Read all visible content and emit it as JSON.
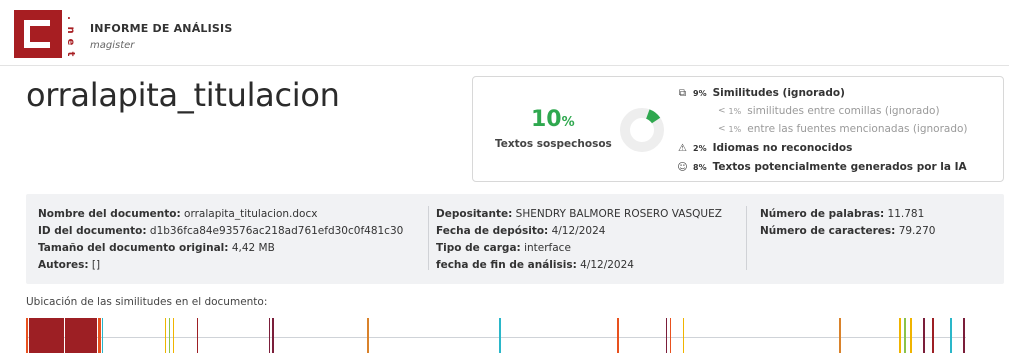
{
  "header": {
    "logo_letter": "C",
    "logo_suffix": ".net",
    "title": "INFORME DE ANÁLISIS",
    "subtitle": "magister",
    "brand_color": "#a71e22"
  },
  "document_title": "orralapita_titulacion",
  "score": {
    "percent_value": "10",
    "percent_symbol": "%",
    "label": "Textos sospechosos",
    "accent_color": "#2fa84f",
    "donut_fraction": 0.1
  },
  "metrics": [
    {
      "icon": "copy-icon",
      "glyph": "⧉",
      "percent": "9%",
      "label": "Similitudes (ignorado)",
      "sub": false
    },
    {
      "icon": "",
      "glyph": "",
      "lt": "<",
      "percent": "1%",
      "label": "similitudes entre comillas (ignorado)",
      "sub": true
    },
    {
      "icon": "",
      "glyph": "",
      "lt": "<",
      "percent": "1%",
      "label": "entre las fuentes mencionadas (ignorado)",
      "sub": true
    },
    {
      "icon": "language-warning-icon",
      "glyph": "⚠",
      "percent": "2%",
      "label": "Idiomas no reconocidos",
      "sub": false
    },
    {
      "icon": "ai-robot-icon",
      "glyph": "☺",
      "percent": "8%",
      "label": "Textos potencialmente generados por la IA",
      "sub": false
    }
  ],
  "info": {
    "col1": [
      {
        "key": "Nombre del documento:",
        "value": "orralapita_titulacion.docx"
      },
      {
        "key": "ID del documento:",
        "value": "d1b36fca84e93576ac218ad761efd30c0f481c30"
      },
      {
        "key": "Tamaño del documento original:",
        "value": "4,42 MB"
      },
      {
        "key": "Autores:",
        "value": "[]"
      }
    ],
    "col2": [
      {
        "key": "Depositante:",
        "value": "SHENDRY BALMORE ROSERO VASQUEZ"
      },
      {
        "key": "Fecha de depósito:",
        "value": "4/12/2024"
      },
      {
        "key": "Tipo de carga:",
        "value": "interface"
      },
      {
        "key": "fecha de fin de análisis:",
        "value": "4/12/2024"
      }
    ],
    "col3": [
      {
        "key": "Número de palabras:",
        "value": "11.781"
      },
      {
        "key": "Número de caracteres:",
        "value": "79.270"
      }
    ]
  },
  "location": {
    "title": "Ubicación de las similitudes en el documento:",
    "markers": [
      {
        "pos": 0.0,
        "width": 0.0022,
        "color": "#e8511e"
      },
      {
        "pos": 0.0031,
        "width": 0.0357,
        "color": "#9d1f24"
      },
      {
        "pos": 0.0398,
        "width": 0.0327,
        "color": "#9d1f24"
      },
      {
        "pos": 0.0735,
        "width": 0.0035,
        "color": "#e8511e"
      },
      {
        "pos": 0.0776,
        "width": 0.0012,
        "color": "#2ab7c9"
      },
      {
        "pos": 0.1418,
        "width": 0.0014,
        "color": "#f0b400"
      },
      {
        "pos": 0.1459,
        "width": 0.0014,
        "color": "#8bc34a"
      },
      {
        "pos": 0.15,
        "width": 0.0012,
        "color": "#f0b400"
      },
      {
        "pos": 0.1745,
        "width": 0.0012,
        "color": "#9d1f24"
      },
      {
        "pos": 0.248,
        "width": 0.0014,
        "color": "#7b1e3a"
      },
      {
        "pos": 0.252,
        "width": 0.0014,
        "color": "#7b1e3a"
      },
      {
        "pos": 0.349,
        "width": 0.0012,
        "color": "#d9822b"
      },
      {
        "pos": 0.4837,
        "width": 0.0012,
        "color": "#2ab7c9"
      },
      {
        "pos": 0.6047,
        "width": 0.0014,
        "color": "#e8511e"
      },
      {
        "pos": 0.6541,
        "width": 0.0014,
        "color": "#7b1e3a"
      },
      {
        "pos": 0.6582,
        "width": 0.0018,
        "color": "#e8511e"
      },
      {
        "pos": 0.6714,
        "width": 0.0012,
        "color": "#f0b400"
      },
      {
        "pos": 0.8316,
        "width": 0.0012,
        "color": "#d9822b"
      },
      {
        "pos": 0.8929,
        "width": 0.0012,
        "color": "#f0b400"
      },
      {
        "pos": 0.898,
        "width": 0.0018,
        "color": "#8bc34a"
      },
      {
        "pos": 0.9041,
        "width": 0.0012,
        "color": "#f0b400"
      },
      {
        "pos": 0.9173,
        "width": 0.0018,
        "color": "#7b1e3a"
      },
      {
        "pos": 0.9265,
        "width": 0.0012,
        "color": "#9d1f24"
      },
      {
        "pos": 0.9449,
        "width": 0.0012,
        "color": "#2ab7c9"
      },
      {
        "pos": 0.9581,
        "width": 0.0014,
        "color": "#7b1e3a"
      }
    ]
  }
}
